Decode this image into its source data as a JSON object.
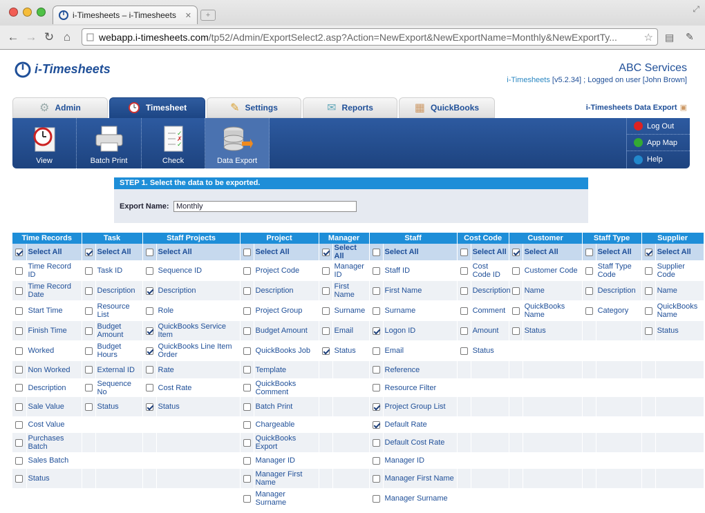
{
  "browser": {
    "tab_title": "i-Timesheets – i-Timesheets",
    "url_host": "webapp.i-timesheets.com",
    "url_path": "/tp52/Admin/ExportSelect2.asp?Action=NewExport&NewExportName=Monthly&NewExportTy..."
  },
  "header": {
    "logo": "i-Timesheets",
    "company": "ABC Services",
    "app_link": "i-Timesheets",
    "version": " [v5.2.34] ; Logged on user [John Brown]"
  },
  "tabs": [
    {
      "label": "Admin"
    },
    {
      "label": "Timesheet"
    },
    {
      "label": "Settings"
    },
    {
      "label": "Reports"
    },
    {
      "label": "QuickBooks"
    }
  ],
  "export_title": "i-Timesheets Data Export",
  "ribbon": {
    "buttons": [
      "View",
      "Batch Print",
      "Check",
      "Data Export"
    ],
    "links": [
      "Log Out",
      "App Map",
      "Help"
    ]
  },
  "step": {
    "heading": "STEP 1. Select the data to be exported.",
    "label": "Export Name:",
    "value": "Monthly"
  },
  "grid": {
    "columns": [
      "Time Records",
      "Task",
      "Staff Projects",
      "Project",
      "Manager",
      "Staff",
      "Cost Code",
      "Customer",
      "Staff Type",
      "Supplier"
    ],
    "select_all_label": "Select All",
    "select_all_checked": [
      true,
      true,
      false,
      false,
      true,
      false,
      false,
      true,
      false,
      true
    ],
    "rows": [
      [
        [
          "Time Record ID",
          0
        ],
        [
          "Task ID",
          0
        ],
        [
          "Sequence ID",
          0
        ],
        [
          "Project Code",
          0
        ],
        [
          "Manager ID",
          0
        ],
        [
          "Staff ID",
          0
        ],
        [
          "Cost Code ID",
          0
        ],
        [
          "Customer Code",
          0
        ],
        [
          "Staff Type Code",
          0
        ],
        [
          "Supplier Code",
          0
        ]
      ],
      [
        [
          "Time Record Date",
          0
        ],
        [
          "Description",
          0
        ],
        [
          "Description",
          1
        ],
        [
          "Description",
          0
        ],
        [
          "First Name",
          0
        ],
        [
          "First Name",
          0
        ],
        [
          "Description",
          0
        ],
        [
          "Name",
          0
        ],
        [
          "Description",
          0
        ],
        [
          "Name",
          0
        ]
      ],
      [
        [
          "Start Time",
          0
        ],
        [
          "Resource List",
          0
        ],
        [
          "Role",
          0
        ],
        [
          "Project Group",
          0
        ],
        [
          "Surname",
          0
        ],
        [
          "Surname",
          0
        ],
        [
          "Comment",
          0
        ],
        [
          "QuickBooks Name",
          0
        ],
        [
          "Category",
          0
        ],
        [
          "QuickBooks Name",
          0
        ]
      ],
      [
        [
          "Finish Time",
          0
        ],
        [
          "Budget Amount",
          0
        ],
        [
          "QuickBooks Service Item",
          1
        ],
        [
          "Budget Amount",
          0
        ],
        [
          "Email",
          0
        ],
        [
          "Logon ID",
          1
        ],
        [
          "Amount",
          0
        ],
        [
          "Status",
          0
        ],
        null,
        [
          "Status",
          0
        ]
      ],
      [
        [
          "Worked",
          0
        ],
        [
          "Budget Hours",
          0
        ],
        [
          "QuickBooks Line Item Order",
          1
        ],
        [
          "QuickBooks Job",
          0
        ],
        [
          "Status",
          1
        ],
        [
          "Email",
          0
        ],
        [
          "Status",
          0
        ],
        null,
        null,
        null
      ],
      [
        [
          "Non Worked",
          0
        ],
        [
          "External ID",
          0
        ],
        [
          "Rate",
          0
        ],
        [
          "Template",
          0
        ],
        null,
        [
          "Reference",
          0
        ],
        null,
        null,
        null,
        null
      ],
      [
        [
          "Description",
          0
        ],
        [
          "Sequence No",
          0
        ],
        [
          "Cost Rate",
          0
        ],
        [
          "QuickBooks Comment",
          0
        ],
        null,
        [
          "Resource Filter",
          0
        ],
        null,
        null,
        null,
        null
      ],
      [
        [
          "Sale Value",
          0
        ],
        [
          "Status",
          0
        ],
        [
          "Status",
          1
        ],
        [
          "Batch Print",
          0
        ],
        null,
        [
          "Project Group List",
          1
        ],
        null,
        null,
        null,
        null
      ],
      [
        [
          "Cost Value",
          0
        ],
        null,
        null,
        [
          "Chargeable",
          0
        ],
        null,
        [
          "Default Rate",
          1
        ],
        null,
        null,
        null,
        null
      ],
      [
        [
          "Purchases Batch",
          0
        ],
        null,
        null,
        [
          "QuickBooks Export",
          0
        ],
        null,
        [
          "Default Cost Rate",
          0
        ],
        null,
        null,
        null,
        null
      ],
      [
        [
          "Sales Batch",
          0
        ],
        null,
        null,
        [
          "Manager ID",
          0
        ],
        null,
        [
          "Manager ID",
          0
        ],
        null,
        null,
        null,
        null
      ],
      [
        [
          "Status",
          0
        ],
        null,
        null,
        [
          "Manager First Name",
          0
        ],
        null,
        [
          "Manager First Name",
          0
        ],
        null,
        null,
        null,
        null
      ],
      [
        null,
        null,
        null,
        [
          "Manager Surname",
          0
        ],
        null,
        [
          "Manager Surname",
          0
        ],
        null,
        null,
        null,
        null
      ]
    ]
  }
}
